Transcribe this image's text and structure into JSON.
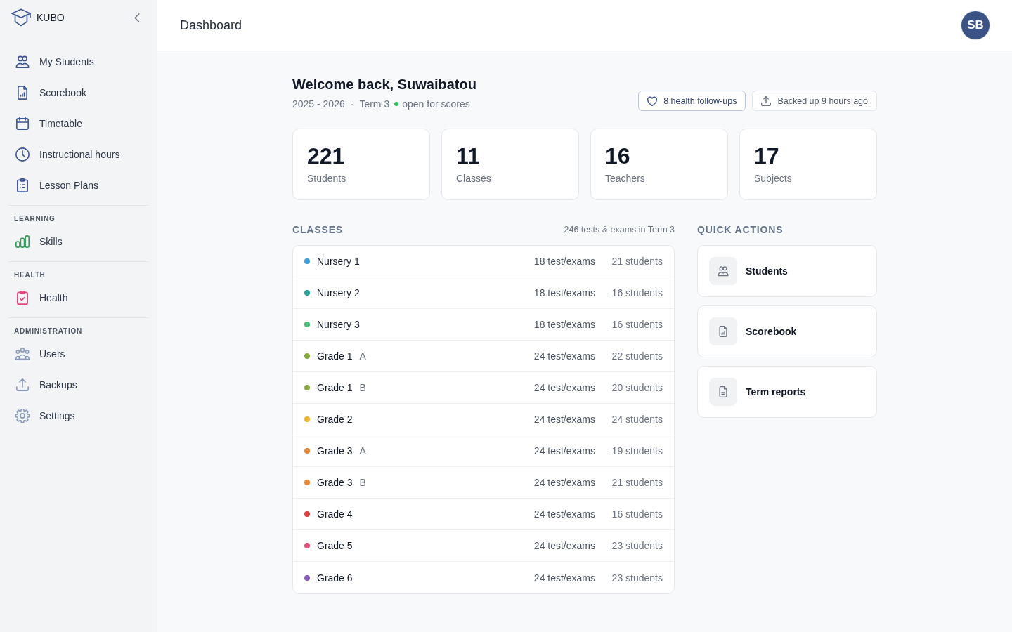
{
  "sidebar": {
    "brand": "KUBO",
    "groups": [
      {
        "items": [
          {
            "label": "My Students",
            "selected": false
          },
          {
            "label": "Scorebook",
            "selected": false
          },
          {
            "label": "Timetable",
            "selected": false
          },
          {
            "label": "Instructional hours",
            "selected": false
          },
          {
            "label": "Lesson Plans",
            "selected": false
          }
        ]
      },
      {
        "heading": "LEARNING",
        "items": [
          {
            "label": "Skills",
            "selected": false
          }
        ]
      },
      {
        "heading": "HEALTH",
        "items": [
          {
            "label": "Health",
            "selected": false
          }
        ]
      },
      {
        "heading": "ADMINISTRATION",
        "items": [
          {
            "label": "Users",
            "selected": false
          },
          {
            "label": "Backups",
            "selected": false
          },
          {
            "label": "Settings",
            "selected": false
          }
        ]
      }
    ]
  },
  "header": {
    "title": "Dashboard",
    "avatar": "SB"
  },
  "welcome": {
    "heading": "Welcome back, Suwaibatou",
    "year": "2025 - 2026",
    "separator": "·",
    "term": "Term 3",
    "status": "open for scores"
  },
  "actions": [
    {
      "kind": "health",
      "label": "8 health follow-ups"
    },
    {
      "kind": "backup",
      "label": "Backed up 9 hours ago"
    }
  ],
  "stats": [
    {
      "value": "221",
      "label": "Students"
    },
    {
      "value": "11",
      "label": "Classes"
    },
    {
      "value": "16",
      "label": "Teachers"
    },
    {
      "value": "17",
      "label": "Subjects"
    }
  ],
  "classes": {
    "heading": "CLASSES",
    "summary": "246 tests & exams in Term 3",
    "rows": [
      {
        "name": "Nursery 1",
        "tests": "18 test/exams",
        "students": "21 students",
        "color": "#3b9ddd"
      },
      {
        "name": "Nursery 2",
        "tests": "18 test/exams",
        "students": "16 students",
        "color": "#26a69a"
      },
      {
        "name": "Nursery 3",
        "tests": "18 test/exams",
        "students": "16 students",
        "color": "#48bb78"
      },
      {
        "name": "Grade 1",
        "section": "A",
        "tests": "24 test/exams",
        "students": "22 students",
        "color": "#8aab3a"
      },
      {
        "name": "Grade 1",
        "section": "B",
        "tests": "24 test/exams",
        "students": "20 students",
        "color": "#8aab3a"
      },
      {
        "name": "Grade 2",
        "tests": "24 test/exams",
        "students": "24 students",
        "color": "#f2b42b"
      },
      {
        "name": "Grade 3",
        "section": "A",
        "tests": "24 test/exams",
        "students": "19 students",
        "color": "#ed8936"
      },
      {
        "name": "Grade 3",
        "section": "B",
        "tests": "24 test/exams",
        "students": "21 students",
        "color": "#ed8936"
      },
      {
        "name": "Grade 4",
        "tests": "24 test/exams",
        "students": "16 students",
        "color": "#e53e3e"
      },
      {
        "name": "Grade 5",
        "tests": "24 test/exams",
        "students": "23 students",
        "color": "#e5527a"
      },
      {
        "name": "Grade 6",
        "tests": "24 test/exams",
        "students": "23 students",
        "color": "#8b5cc8"
      }
    ]
  },
  "quick_actions": {
    "heading": "QUICK ACTIONS",
    "items": [
      {
        "label": "Students"
      },
      {
        "label": "Scorebook"
      },
      {
        "label": "Term reports"
      }
    ]
  }
}
